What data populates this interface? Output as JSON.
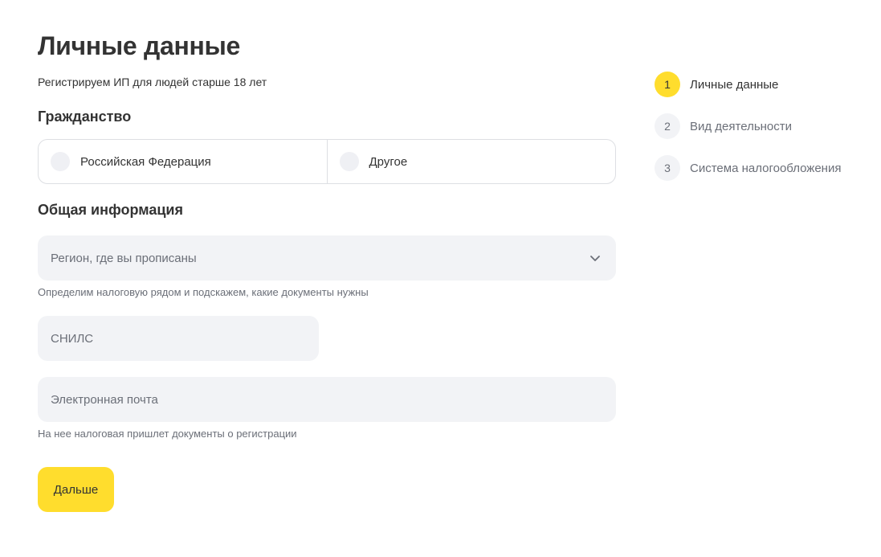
{
  "header": {
    "title": "Личные данные",
    "subtitle": "Регистрируем ИП для людей старше 18 лет"
  },
  "citizenship": {
    "title": "Гражданство",
    "options": [
      {
        "label": "Российская Федерация",
        "selected": false
      },
      {
        "label": "Другое",
        "selected": false
      }
    ]
  },
  "general": {
    "title": "Общая информация",
    "region": {
      "placeholder": "Регион, где вы прописаны",
      "value": "",
      "hint": "Определим налоговую рядом и подскажем, какие документы нужны",
      "icon": "chevron-down-icon"
    },
    "snils": {
      "placeholder": "СНИЛС",
      "value": ""
    },
    "email": {
      "placeholder": "Электронная почта",
      "value": "",
      "hint": "На нее налоговая пришлет документы о регистрации"
    }
  },
  "actions": {
    "next_label": "Дальше"
  },
  "steps": [
    {
      "number": "1",
      "label": "Личные данные",
      "active": true
    },
    {
      "number": "2",
      "label": "Вид деятельности",
      "active": false
    },
    {
      "number": "3",
      "label": "Система налогообложения",
      "active": false
    }
  ],
  "colors": {
    "accent": "#ffdd2d",
    "field_bg": "#f2f3f6",
    "text": "#333333",
    "muted": "#6b6f78",
    "border": "#dddfe3"
  }
}
